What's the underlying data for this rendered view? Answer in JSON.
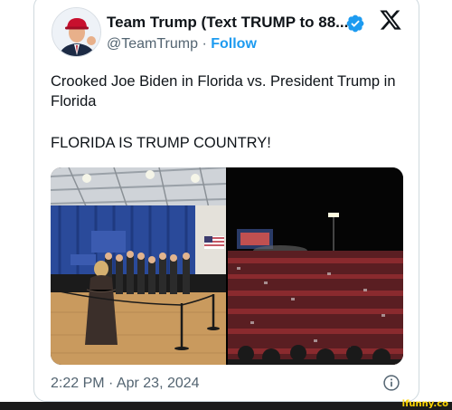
{
  "tweet": {
    "display_name": "Team Trump (Text TRUMP to 88...",
    "handle": "@TeamTrump",
    "separator": "·",
    "follow_label": "Follow",
    "text_line1": "Crooked Joe Biden in Florida vs. President Trump in Florida",
    "text_line2": "FLORIDA IS TRUMP COUNTRY!",
    "timestamp": "2:22 PM · Apr 23, 2024"
  },
  "icons": {
    "verified": "verified-badge-icon",
    "platform": "x-logo-icon",
    "info": "info-icon"
  },
  "colors": {
    "accent": "#1d9bf0",
    "secondary_text": "#536471"
  },
  "watermark": "ifunny.co"
}
